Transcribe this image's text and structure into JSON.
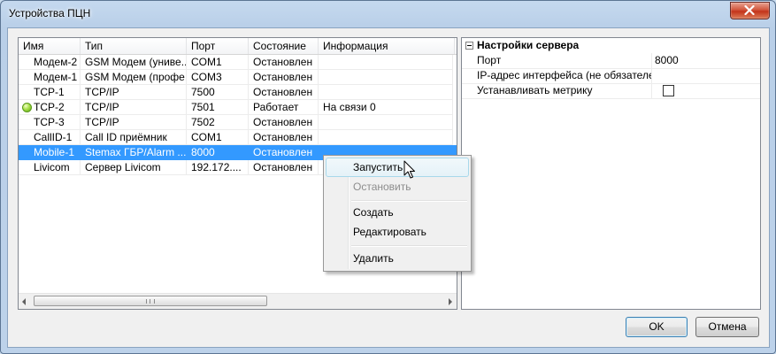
{
  "window": {
    "title": "Устройства ПЦН"
  },
  "list": {
    "columns": [
      "Имя",
      "Тип",
      "Порт",
      "Состояние",
      "Информация"
    ],
    "rows": [
      {
        "name": "Модем-2",
        "type": "GSM Модем (униве...",
        "port": "COM1",
        "state": "Остановлен",
        "info": "",
        "active": false,
        "selected": false
      },
      {
        "name": "Модем-1",
        "type": "GSM Модем (профе...",
        "port": "COM3",
        "state": "Остановлен",
        "info": "",
        "active": false,
        "selected": false
      },
      {
        "name": "TCP-1",
        "type": "TCP/IP",
        "port": "7500",
        "state": "Остановлен",
        "info": "",
        "active": false,
        "selected": false
      },
      {
        "name": "TCP-2",
        "type": "TCP/IP",
        "port": "7501",
        "state": "Работает",
        "info": "На связи 0",
        "active": true,
        "selected": false
      },
      {
        "name": "TCP-3",
        "type": "TCP/IP",
        "port": "7502",
        "state": "Остановлен",
        "info": "",
        "active": false,
        "selected": false
      },
      {
        "name": "CallID-1",
        "type": "Call ID приёмник",
        "port": "COM1",
        "state": "Остановлен",
        "info": "",
        "active": false,
        "selected": false
      },
      {
        "name": "Mobile-1",
        "type": "Stemax ГБР/Alarm ...",
        "port": "8000",
        "state": "Остановлен",
        "info": "",
        "active": false,
        "selected": true
      },
      {
        "name": "Livicom",
        "type": "Сервер Livicom",
        "port": "192.172....",
        "state": "Остановлен",
        "info": "",
        "active": false,
        "selected": false
      }
    ]
  },
  "properties": {
    "category": "Настройки сервера",
    "items": [
      {
        "name": "Порт",
        "value": "8000"
      },
      {
        "name": "IP-адрес интерфейса (не обязателен)",
        "value": ""
      },
      {
        "name": "Устанавливать метрику",
        "value": ""
      }
    ],
    "metric_checked": false
  },
  "context_menu": {
    "start": "Запустить",
    "stop": "Остановить",
    "create": "Создать",
    "edit": "Редактировать",
    "delete": "Удалить"
  },
  "buttons": {
    "ok": "OK",
    "cancel": "Отмена"
  },
  "colors": {
    "selection": "#3399ff",
    "active_status": "#8fd13a",
    "titlebar": "#bcd2ea",
    "close_button": "#c7381e"
  },
  "icons": {
    "close": "close-icon",
    "status": "status-online-icon",
    "cursor": "mouse-pointer-icon"
  }
}
